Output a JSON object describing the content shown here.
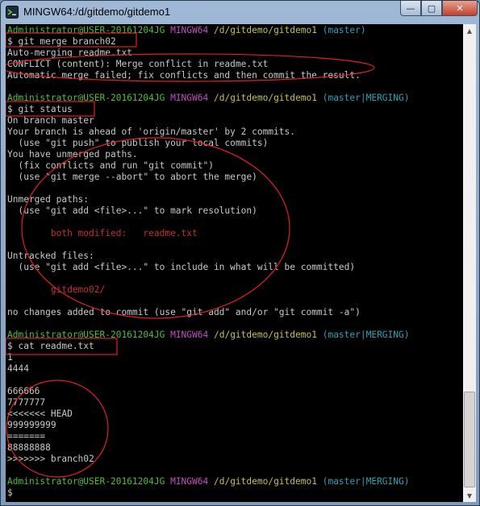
{
  "window": {
    "title": "MINGW64:/d/gitdemo/gitdemo1",
    "controls": {
      "minimize": "—",
      "maximize": "▢",
      "close": "✕"
    }
  },
  "terminal": {
    "lines": [
      [
        {
          "t": "Administrator@USER-20161204JG",
          "c": "green"
        },
        {
          "t": " "
        },
        {
          "t": "MINGW64",
          "c": "magenta"
        },
        {
          "t": " "
        },
        {
          "t": "/d/gitdemo/gitdemo1",
          "c": "yellow"
        },
        {
          "t": " "
        },
        {
          "t": "(master)",
          "c": "cyan"
        }
      ],
      [
        {
          "t": "$ git merge branch02"
        }
      ],
      [
        {
          "t": "Auto-merging readme.txt"
        }
      ],
      [
        {
          "t": "CONFLICT (content): Merge conflict in readme.txt"
        }
      ],
      [
        {
          "t": "Automatic merge failed; fix conflicts and then commit the result."
        }
      ],
      [
        {
          "t": ""
        }
      ],
      [
        {
          "t": "Administrator@USER-20161204JG",
          "c": "green"
        },
        {
          "t": " "
        },
        {
          "t": "MINGW64",
          "c": "magenta"
        },
        {
          "t": " "
        },
        {
          "t": "/d/gitdemo/gitdemo1",
          "c": "yellow"
        },
        {
          "t": " "
        },
        {
          "t": "(master|MERGING)",
          "c": "cyan"
        }
      ],
      [
        {
          "t": "$ git status"
        }
      ],
      [
        {
          "t": "On branch master"
        }
      ],
      [
        {
          "t": "Your branch is ahead of 'origin/master' by 2 commits."
        }
      ],
      [
        {
          "t": "  (use \"git push\" to publish your local commits)"
        }
      ],
      [
        {
          "t": "You have unmerged paths."
        }
      ],
      [
        {
          "t": "  (fix conflicts and run \"git commit\")"
        }
      ],
      [
        {
          "t": "  (use \"git merge --abort\" to abort the merge)"
        }
      ],
      [
        {
          "t": ""
        }
      ],
      [
        {
          "t": "Unmerged paths:"
        }
      ],
      [
        {
          "t": "  (use \"git add <file>...\" to mark resolution)"
        }
      ],
      [
        {
          "t": ""
        }
      ],
      [
        {
          "t": "        both modified:   readme.txt",
          "c": "red"
        }
      ],
      [
        {
          "t": ""
        }
      ],
      [
        {
          "t": "Untracked files:"
        }
      ],
      [
        {
          "t": "  (use \"git add <file>...\" to include in what will be committed)"
        }
      ],
      [
        {
          "t": ""
        }
      ],
      [
        {
          "t": "        gitdemo02/",
          "c": "red"
        }
      ],
      [
        {
          "t": ""
        }
      ],
      [
        {
          "t": "no changes added to commit (use \"git add\" and/or \"git commit -a\")"
        }
      ],
      [
        {
          "t": ""
        }
      ],
      [
        {
          "t": "Administrator@USER-20161204JG",
          "c": "green"
        },
        {
          "t": " "
        },
        {
          "t": "MINGW64",
          "c": "magenta"
        },
        {
          "t": " "
        },
        {
          "t": "/d/gitdemo/gitdemo1",
          "c": "yellow"
        },
        {
          "t": " "
        },
        {
          "t": "(master|MERGING)",
          "c": "cyan"
        }
      ],
      [
        {
          "t": "$ cat readme.txt"
        }
      ],
      [
        {
          "t": "1"
        }
      ],
      [
        {
          "t": "4444"
        }
      ],
      [
        {
          "t": ""
        }
      ],
      [
        {
          "t": "666666"
        }
      ],
      [
        {
          "t": "7777777"
        }
      ],
      [
        {
          "t": "<<<<<<< HEAD"
        }
      ],
      [
        {
          "t": "999999999"
        }
      ],
      [
        {
          "t": "======="
        }
      ],
      [
        {
          "t": "88888888"
        }
      ],
      [
        {
          "t": ">>>>>>> branch02"
        }
      ],
      [
        {
          "t": ""
        }
      ],
      [
        {
          "t": "Administrator@USER-20161204JG",
          "c": "green"
        },
        {
          "t": " "
        },
        {
          "t": "MINGW64",
          "c": "magenta"
        },
        {
          "t": " "
        },
        {
          "t": "/d/gitdemo/gitdemo1",
          "c": "yellow"
        },
        {
          "t": " "
        },
        {
          "t": "(master|MERGING)",
          "c": "cyan"
        }
      ],
      [
        {
          "t": "$ "
        }
      ]
    ]
  },
  "colors": {
    "green": "#4fbf3a",
    "magenta": "#c04fc0",
    "yellow": "#c8c040",
    "cyan": "#2aa1b3",
    "red": "#c03030",
    "default": "#c8c8c8",
    "annotation": "#e02020"
  },
  "scrollbar": {
    "up_icon": "▲",
    "down_icon": "▼"
  }
}
